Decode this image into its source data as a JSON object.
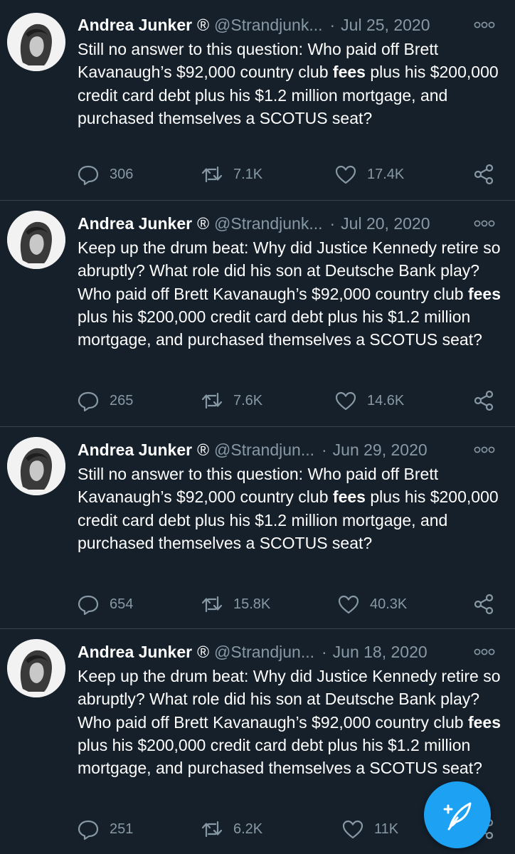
{
  "colors": {
    "background": "#15202b",
    "divider": "#38444d",
    "secondary_text": "#8899a6",
    "accent": "#1da1f2"
  },
  "tweets": [
    {
      "name": "Andrea Junker",
      "badge": "®",
      "handle": "@Strandjunk...",
      "separator": "·",
      "date": "Jul 25, 2020",
      "body": [
        {
          "t": "Still no answer to this question: Who paid off Brett Kavanaugh’s $92,000 country club "
        },
        {
          "t": "fees",
          "b": true
        },
        {
          "t": " plus his $200,000 credit card debt plus his $1.2 million mortgage, and purchased themselves a SCOTUS seat?"
        }
      ],
      "replies": "306",
      "retweets": "7.1K",
      "likes": "17.4K"
    },
    {
      "name": "Andrea Junker",
      "badge": "®",
      "handle": "@Strandjunk...",
      "separator": "·",
      "date": "Jul 20, 2020",
      "body": [
        {
          "t": "Keep up the drum beat: Why did Justice Kennedy retire so abruptly? What role did his son at Deutsche Bank play? Who paid off Brett Kavanaugh’s $92,000 country club "
        },
        {
          "t": "fees",
          "b": true
        },
        {
          "t": " plus his $200,000 credit card debt plus his $1.2 million mortgage, and purchased themselves a SCOTUS seat?"
        }
      ],
      "replies": "265",
      "retweets": "7.6K",
      "likes": "14.6K"
    },
    {
      "name": "Andrea Junker",
      "badge": "®",
      "handle": "@Strandjun...",
      "separator": "·",
      "date": "Jun 29, 2020",
      "body": [
        {
          "t": "Still no answer to this question: Who paid off Brett Kavanaugh’s $92,000 country club "
        },
        {
          "t": "fees",
          "b": true
        },
        {
          "t": " plus his $200,000 credit card debt plus his $1.2 million mortgage, and purchased themselves a SCOTUS seat?"
        }
      ],
      "replies": "654",
      "retweets": "15.8K",
      "likes": "40.3K"
    },
    {
      "name": "Andrea Junker",
      "badge": "®",
      "handle": "@Strandjun...",
      "separator": "·",
      "date": "Jun 18, 2020",
      "body": [
        {
          "t": "Keep up the drum beat: Why did Justice Kennedy retire so abruptly? What role did his son at Deutsche Bank play? Who paid off Brett Kavanaugh’s $92,000 country club "
        },
        {
          "t": "fees",
          "b": true
        },
        {
          "t": " plus his $200,000 credit card debt plus his $1.2 million mortgage, and purchased themselves a SCOTUS seat?"
        }
      ],
      "replies": "251",
      "retweets": "6.2K",
      "likes": "11K"
    }
  ],
  "icons": {
    "reply": "reply-icon",
    "retweet": "retweet-icon",
    "like": "heart-icon",
    "share": "share-icon",
    "more": "more-icon",
    "compose": "compose-tweet-icon"
  }
}
